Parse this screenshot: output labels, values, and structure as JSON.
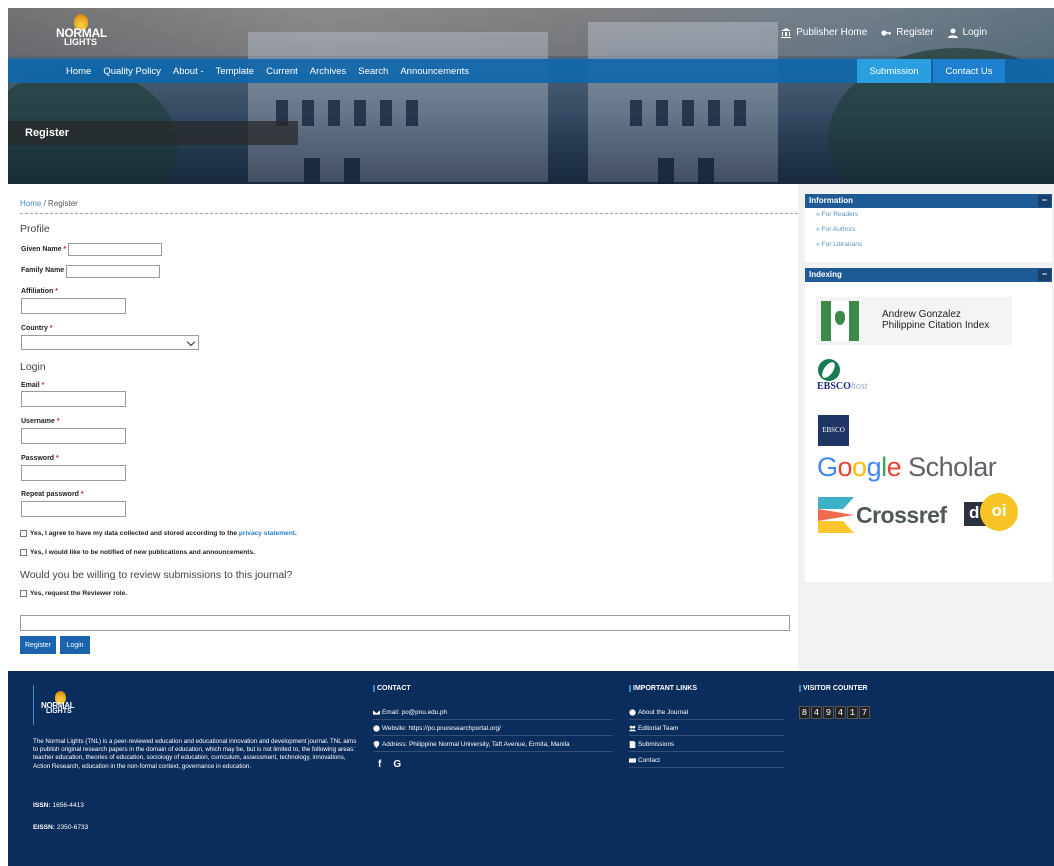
{
  "brand": {
    "logo_line1": "NORMAL",
    "logo_line2": "LIGHTS"
  },
  "top_links": [
    {
      "label": "Publisher Home",
      "icon": "bank-icon"
    },
    {
      "label": "Register",
      "icon": "key-icon"
    },
    {
      "label": "Login",
      "icon": "user-icon"
    }
  ],
  "nav": {
    "items": [
      "Home",
      "Quality Policy",
      "About -",
      "Template",
      "Current",
      "Archives",
      "Search",
      "Announcements"
    ],
    "submission": "Submission",
    "contact": "Contact Us",
    "accent": "#1067ab"
  },
  "page_title": "Register",
  "breadcrumb": {
    "home": "Home",
    "sep": "/",
    "current": "Register"
  },
  "form": {
    "profile_heading": "Profile",
    "given_name": "Given Name",
    "family_name": "Family Name",
    "affiliation": "Affiliation",
    "country": "Country",
    "login_heading": "Login",
    "email": "Email",
    "username": "Username",
    "password": "Password",
    "repeat_password": "Repeat password",
    "required_mark": "*",
    "consent_text": "Yes, I agree to have my data collected and stored according to the ",
    "consent_link": "privacy statement",
    "consent_end": ".",
    "notify_text": "Yes, I would like to be notified of new publications and announcements.",
    "review_question": "Would you be willing to review submissions to this journal?",
    "reviewer_text": "Yes, request the Reviewer role.",
    "register_button": "Register",
    "login_button": "Login"
  },
  "sidebar": {
    "information_title": "Information",
    "collapse_symbol": "−",
    "info_links": [
      "» For Readers",
      "» For Authors",
      "» For Librarians"
    ],
    "indexing_title": "Indexing",
    "agpci_line1": "Andrew Gonzalez",
    "agpci_line2": "Philippine Citation Index",
    "ebsco_host_main": "EBSCO",
    "ebsco_host_sub": "host",
    "ebsco_box": "EBSCO",
    "gs_letters": [
      "G",
      "o",
      "o",
      "g",
      "l",
      "e"
    ],
    "gs_word": "Scholar",
    "crossref": "Crossref",
    "doi_d": "d",
    "doi_rest": "oi"
  },
  "footer": {
    "logo_line1": "NORMAL",
    "logo_line2": "LIGHTS",
    "about": "The Normal Lights (TNL) is a peer-reviewed education and educational innovation and development journal. TNL aims to publish original research papers in the domain of education, which may be, but is not limited to, the following areas: teacher education, theories of education, sociology of education, curriculum, assessment, technology, innovations, Action Research, education in the non-formal context, governance in education.",
    "issn_label": "ISSN:",
    "issn": " 1656-4413",
    "eissn_label": "EISSN:",
    "eissn": " 2350-6733",
    "contact_title": "CONTACT",
    "email_label": "Email: po@pnu.edu.ph",
    "website_label": "Website: https://po.pnuresearchportal.org/",
    "address_label": "Address: Philippine Normal University, Taft Avenue, Ermita, Manila",
    "social": [
      "f",
      "G"
    ],
    "links_title": "IMPORTANT LINKS",
    "links": [
      "About the Journal",
      "Editorial Team",
      "Submissions",
      "Contact"
    ],
    "counter_title": "VISITOR COUNTER",
    "counter_digits": [
      "8",
      "4",
      "9",
      "4",
      "1",
      "7"
    ]
  }
}
